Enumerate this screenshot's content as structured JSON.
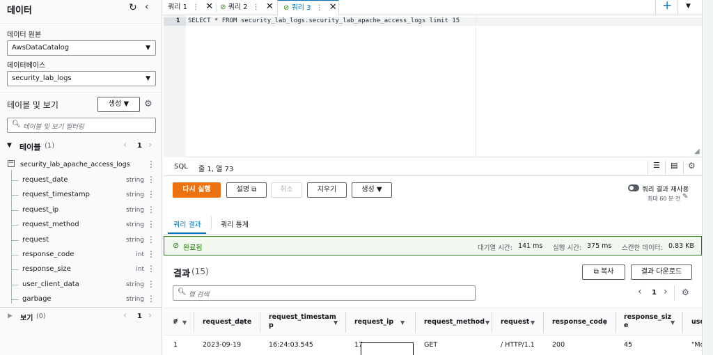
{
  "sidebar": {
    "title": "데이터",
    "data_source_label": "데이터 원본",
    "data_source_value": "AwsDataCatalog",
    "database_label": "데이터베이스",
    "database_value": "security_lab_logs",
    "tables_views_label": "테이블 및 보기",
    "create_label": "생성",
    "filter_placeholder": "테이블 및 보기 필터링",
    "tables_label": "테이블",
    "tables_count": "(1)",
    "tables_page": "1",
    "table_name": "security_lab_apache_access_logs",
    "columns": [
      {
        "name": "request_date",
        "type": "string"
      },
      {
        "name": "request_timestamp",
        "type": "string"
      },
      {
        "name": "request_ip",
        "type": "string"
      },
      {
        "name": "request_method",
        "type": "string"
      },
      {
        "name": "request",
        "type": "string"
      },
      {
        "name": "response_code",
        "type": "int"
      },
      {
        "name": "response_size",
        "type": "int"
      },
      {
        "name": "user_client_data",
        "type": "string"
      },
      {
        "name": "garbage",
        "type": "string"
      }
    ],
    "views_label": "보기",
    "views_count": "(0)",
    "views_page": "1"
  },
  "tabs": [
    {
      "label": "쿼리 1"
    },
    {
      "label": "쿼리 2"
    },
    {
      "label": "쿼리 3"
    }
  ],
  "editor": {
    "line_number": "1",
    "code": "SELECT * FROM security_lab_logs.security_lab_apache_access_logs limit 15"
  },
  "status": {
    "mode": "SQL",
    "position": "줄 1, 열 73"
  },
  "actions": {
    "run_again": "다시 실행",
    "explain": "설명",
    "cancel": "취소",
    "clear": "지우기",
    "create": "생성",
    "reuse_toggle": "쿼리 결과 재사용",
    "reuse_sub": "최대 60 분 전"
  },
  "result_tabs": {
    "results": "쿼리 결과",
    "stats": "쿼리 통계"
  },
  "completion": {
    "status": "완료됨",
    "queue_label": "대기열 시간:",
    "queue_value": "141 ms",
    "run_label": "실행 시간:",
    "run_value": "375 ms",
    "scanned_label": "스캔한 데이터:",
    "scanned_value": "0.83 KB"
  },
  "results": {
    "title": "결과",
    "count": "(15)",
    "copy": "복사",
    "download": "결과 다운로드",
    "search_placeholder": "행 검색",
    "page": "1",
    "columns": [
      "#",
      "request_date",
      "request_timestam\np",
      "request_ip",
      "request_method",
      "request",
      "response_code",
      "response_siz\ne",
      "use"
    ],
    "row": [
      "1",
      "2023-09-19",
      "16:24:03.545",
      "17",
      "GET",
      "/ HTTP/1.1",
      "200",
      "45",
      "\"Mc"
    ]
  }
}
